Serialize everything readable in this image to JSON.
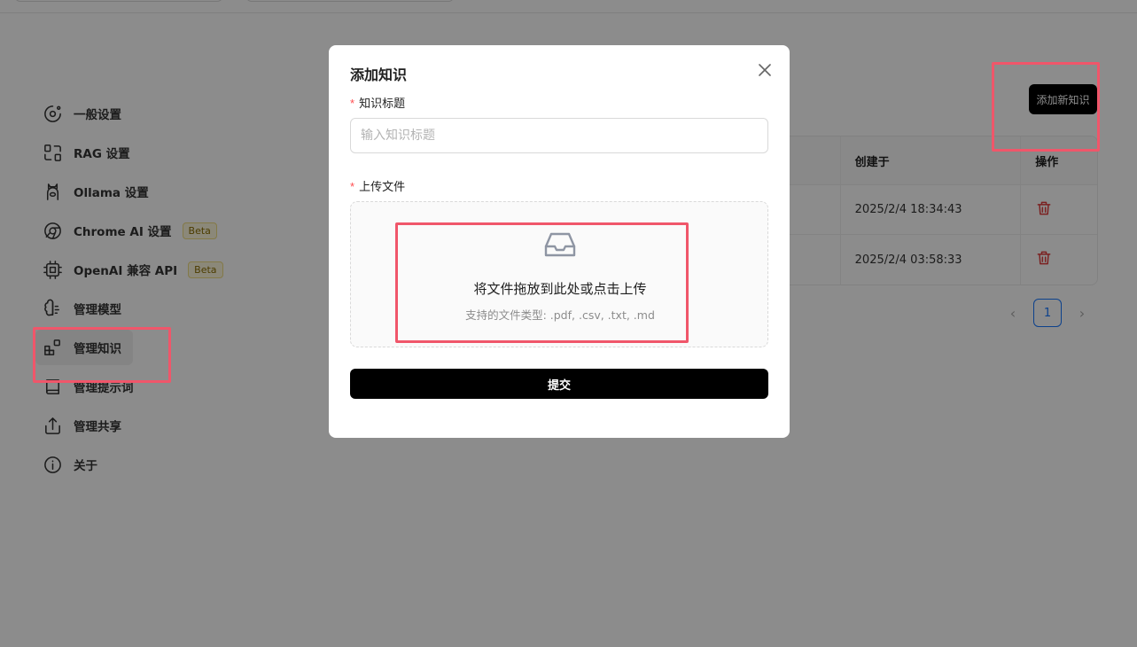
{
  "sidebar": {
    "items": [
      {
        "label": "一般设置",
        "icon": "settings-icon"
      },
      {
        "label": "RAG 设置",
        "icon": "rag-icon"
      },
      {
        "label": "Ollama 设置",
        "icon": "llama-icon"
      },
      {
        "label": "Chrome AI 设置",
        "icon": "chrome-icon",
        "badge": "Beta"
      },
      {
        "label": "OpenAI 兼容 API",
        "icon": "chip-icon",
        "badge": "Beta"
      },
      {
        "label": "管理模型",
        "icon": "brain-icon"
      },
      {
        "label": "管理知识",
        "icon": "blocks-icon",
        "active": true
      },
      {
        "label": "管理提示词",
        "icon": "book-icon"
      },
      {
        "label": "管理共享",
        "icon": "share-icon"
      },
      {
        "label": "关于",
        "icon": "info-icon"
      }
    ]
  },
  "header": {
    "add_button_label": "添加新知识"
  },
  "table": {
    "columns": [
      "",
      "创建于",
      "操作"
    ],
    "rows": [
      {
        "created": "2025/2/4 18:34:43"
      },
      {
        "created": "2025/2/4 03:58:33"
      }
    ]
  },
  "pagination": {
    "current_page": "1"
  },
  "modal": {
    "title": "添加知识",
    "title_field_label": "知识标题",
    "title_field_placeholder": "输入知识标题",
    "upload_field_label": "上传文件",
    "upload_text": "将文件拖放到此处或点击上传",
    "upload_hint": "支持的文件类型: .pdf, .csv, .txt, .md",
    "submit_label": "提交",
    "required_mark": "*"
  },
  "colors": {
    "highlight": "#f0566a",
    "primary_button": "#000000",
    "delete_icon": "#e03d3d",
    "pagination_accent": "#1677ff"
  }
}
